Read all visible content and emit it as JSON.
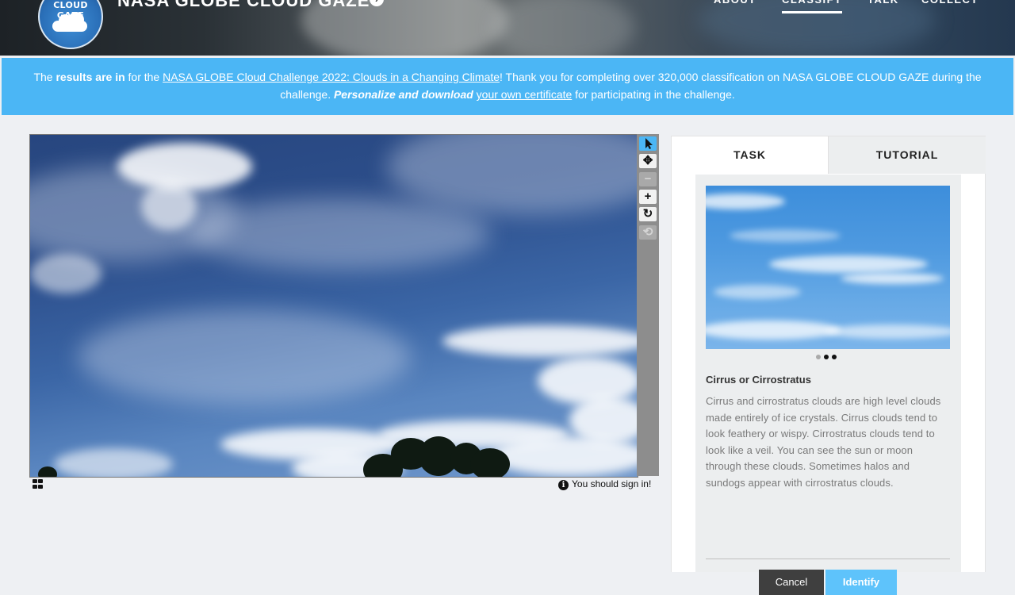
{
  "header": {
    "logo_text": "CLOUD GAZE",
    "site_title": "NASA GLOBE CLOUD GAZE",
    "nav": [
      {
        "label": "ABOUT"
      },
      {
        "label": "CLASSIFY"
      },
      {
        "label": "TALK"
      },
      {
        "label": "COLLECT"
      }
    ]
  },
  "banner": {
    "t1": "The ",
    "results": "results are in",
    "t2": " for the ",
    "challenge_link": "NASA GLOBE Cloud Challenge 2022: Clouds in a Changing Climate",
    "t3": "! Thank you for completing over 320,000 classification on NASA GLOBE CLOUD GAZE during the challenge. ",
    "personalize": "Personalize and download",
    "space": " ",
    "certificate_link": "your own certificate",
    "t4": " for participating in the challenge."
  },
  "viewer": {
    "signin_text": "You should sign in!",
    "tools": [
      "pointer-icon",
      "move-icon",
      "zoom-out-icon",
      "zoom-in-icon",
      "rotate-icon",
      "reset-icon"
    ]
  },
  "panel": {
    "tabs": [
      {
        "label": "TASK"
      },
      {
        "label": "TUTORIAL"
      }
    ],
    "cloud_name": "Cirrus or Cirrostratus",
    "cloud_description": "Cirrus and cirrostratus clouds are high level clouds made entirely of ice crystals. Cirrus clouds tend to look feathery or wispy. Cirrostratus clouds tend to look like a veil. You can see the sun or moon through these clouds. Sometimes halos and sundogs appear with cirrostratus clouds.",
    "cancel_label": "Cancel",
    "identify_label": "Identify"
  },
  "colors": {
    "banner": "#4bb6f5",
    "identify": "#5ec3fb",
    "cancel": "#3f3f3f"
  }
}
